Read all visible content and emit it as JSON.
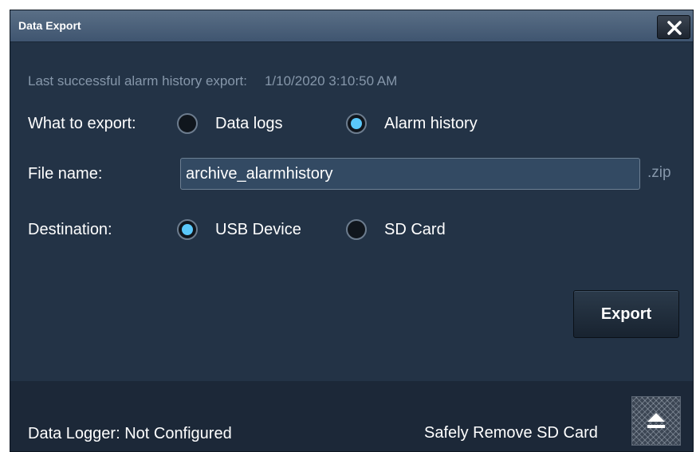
{
  "dialog": {
    "title": "Data Export",
    "close_icon": "close-icon"
  },
  "last_export": {
    "label": "Last successful alarm history export:",
    "timestamp": "1/10/2020 3:10:50 AM"
  },
  "what_to_export": {
    "label": "What to export:",
    "options": [
      {
        "label": "Data logs",
        "selected": false
      },
      {
        "label": "Alarm history",
        "selected": true
      }
    ]
  },
  "file_name": {
    "label": "File name:",
    "value": "archive_alarmhistory",
    "extension": ".zip"
  },
  "destination": {
    "label": "Destination:",
    "options": [
      {
        "label": "USB Device",
        "selected": true
      },
      {
        "label": "SD Card",
        "selected": false
      }
    ]
  },
  "actions": {
    "export_label": "Export"
  },
  "footer": {
    "status": "Data Logger: Not Configured",
    "safely_remove_label": "Safely Remove SD Card",
    "eject_icon": "eject-icon"
  },
  "colors": {
    "background": "#233346",
    "accent": "#5ac8fa",
    "muted_text": "#8697aa"
  }
}
